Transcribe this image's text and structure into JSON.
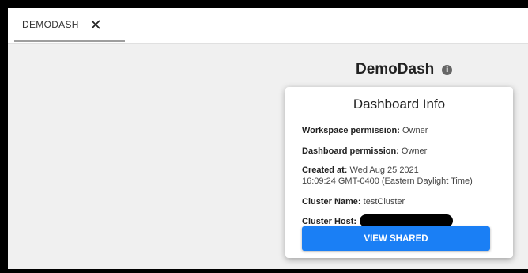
{
  "tab": {
    "label": "DEMODASH",
    "close_icon": "close-icon"
  },
  "dashboard": {
    "title": "DemoDash",
    "info_icon": "info-icon",
    "info_glyph": "i"
  },
  "popover": {
    "title": "Dashboard Info",
    "workspace_permission_label": "Workspace permission:",
    "workspace_permission_value": "Owner",
    "dashboard_permission_label": "Dashboard permission:",
    "dashboard_permission_value": "Owner",
    "created_at_label": "Created at:",
    "created_at_value_line1": "Wed Aug 25 2021",
    "created_at_value_line2": "16:09:24 GMT-0400 (Eastern Daylight Time)",
    "cluster_name_label": "Cluster Name:",
    "cluster_name_value": "testCluster",
    "cluster_host_label": "Cluster Host:",
    "button_label": "VIEW SHARED"
  },
  "colors": {
    "accent": "#1a7ff5",
    "background": "#f0f0f0"
  }
}
